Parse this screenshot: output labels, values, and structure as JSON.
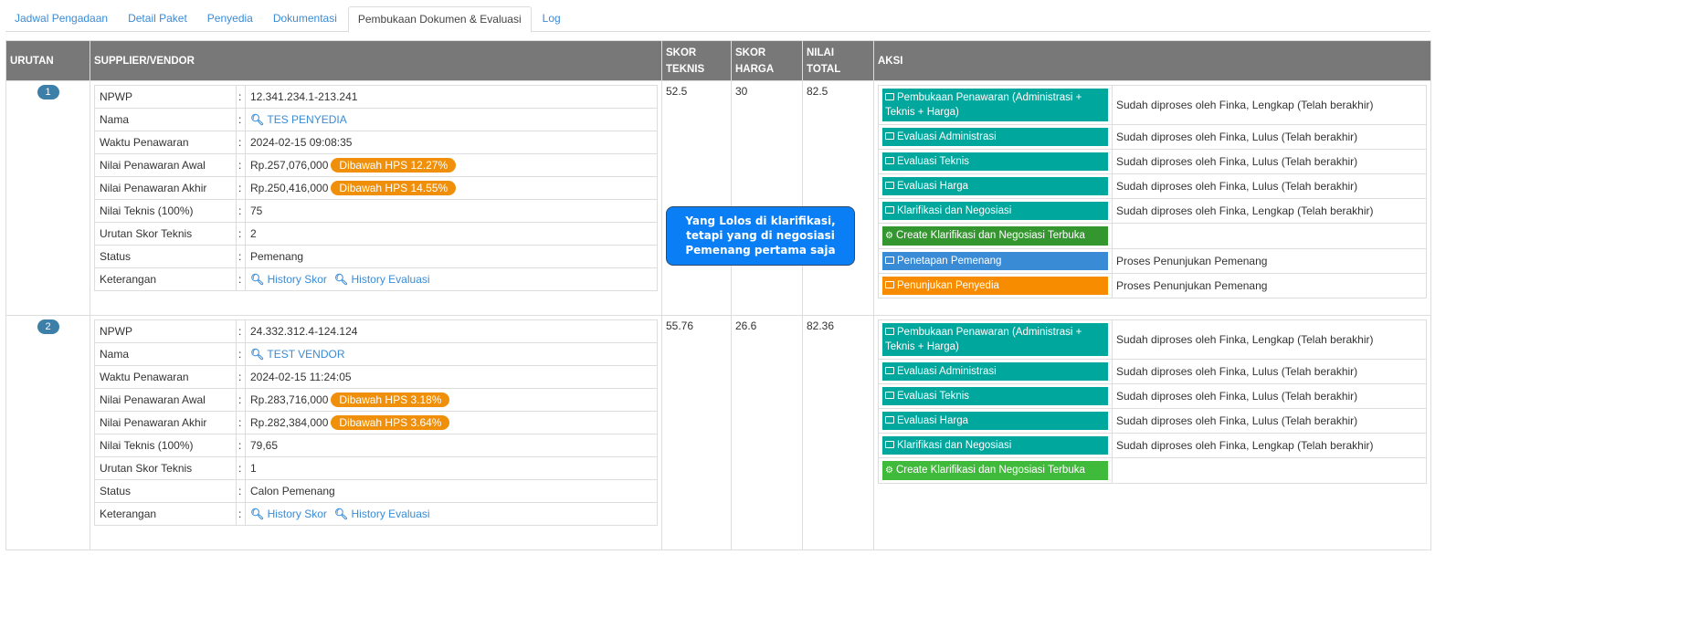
{
  "tabs": [
    "Jadwal Pengadaan",
    "Detail Paket",
    "Penyedia",
    "Dokumentasi",
    "Pembukaan Dokumen & Evaluasi",
    "Log"
  ],
  "active_tab": 4,
  "headers": {
    "urutan": "URUTAN",
    "supplier": "SUPPLIER/VENDOR",
    "skor_teknis": "SKOR TEKNIS",
    "skor_harga": "SKOR HARGA",
    "nilai_total": "NILAI TOTAL",
    "aksi": "AKSI"
  },
  "labels": [
    "NPWP",
    "Nama",
    "Waktu Penawaran",
    "Nilai Penawaran Awal",
    "Nilai Penawaran Akhir",
    "Nilai Teknis (100%)",
    "Urutan Skor Teknis",
    "Status",
    "Keterangan"
  ],
  "links": {
    "history_skor": "History Skor",
    "history_evaluasi": "History Evaluasi"
  },
  "rows": [
    {
      "urutan": "1",
      "npwp": "12.341.234.1-213.241",
      "nama": "TES PENYEDIA",
      "waktu": "2024-02-15 09:08:35",
      "awal": "Rp.257,076,000",
      "awal_badge": "Dibawah HPS 12.27%",
      "akhir": "Rp.250,416,000",
      "akhir_badge": "Dibawah HPS 14.55%",
      "nilai_teknis": "75",
      "urutan_skor": "2",
      "status": "Pemenang",
      "skor_teknis": "52.5",
      "skor_harga": "30",
      "nilai_total": "82.5",
      "aksi": [
        {
          "label": "Pembukaan Penawaran (Administrasi + Teknis + Harga)",
          "status": "Sudah diproses oleh Finka, Lengkap (Telah berakhir)",
          "color": "teal",
          "icon": "monitor"
        },
        {
          "label": "Evaluasi Administrasi",
          "status": "Sudah diproses oleh Finka, Lulus (Telah berakhir)",
          "color": "teal",
          "icon": "monitor"
        },
        {
          "label": "Evaluasi Teknis",
          "status": "Sudah diproses oleh Finka, Lulus (Telah berakhir)",
          "color": "teal",
          "icon": "monitor"
        },
        {
          "label": "Evaluasi Harga",
          "status": "Sudah diproses oleh Finka, Lulus (Telah berakhir)",
          "color": "teal",
          "icon": "monitor"
        },
        {
          "label": "Klarifikasi dan Negosiasi",
          "status": "Sudah diproses oleh Finka, Lengkap (Telah berakhir)",
          "color": "teal",
          "icon": "monitor"
        },
        {
          "label": "Create Klarifikasi dan Negosiasi Terbuka",
          "status": "",
          "color": "green",
          "icon": "gear"
        },
        {
          "label": "Penetapan Pemenang",
          "status": "Proses Penunjukan Pemenang",
          "color": "blue",
          "icon": "monitor"
        },
        {
          "label": "Penunjukan Penyedia",
          "status": "Proses Penunjukan Pemenang",
          "color": "orange",
          "icon": "monitor"
        }
      ]
    },
    {
      "urutan": "2",
      "npwp": "24.332.312.4-124.124",
      "nama": "TEST VENDOR",
      "waktu": "2024-02-15 11:24:05",
      "awal": "Rp.283,716,000",
      "awal_badge": "Dibawah HPS 3.18%",
      "akhir": "Rp.282,384,000",
      "akhir_badge": "Dibawah HPS 3.64%",
      "nilai_teknis": "79,65",
      "urutan_skor": "1",
      "status": "Calon Pemenang",
      "skor_teknis": "55.76",
      "skor_harga": "26.6",
      "nilai_total": "82.36",
      "aksi": [
        {
          "label": "Pembukaan Penawaran (Administrasi + Teknis + Harga)",
          "status": "Sudah diproses oleh Finka, Lengkap (Telah berakhir)",
          "color": "teal",
          "icon": "monitor"
        },
        {
          "label": "Evaluasi Administrasi",
          "status": "Sudah diproses oleh Finka, Lulus (Telah berakhir)",
          "color": "teal",
          "icon": "monitor"
        },
        {
          "label": "Evaluasi Teknis",
          "status": "Sudah diproses oleh Finka, Lulus (Telah berakhir)",
          "color": "teal",
          "icon": "monitor"
        },
        {
          "label": "Evaluasi Harga",
          "status": "Sudah diproses oleh Finka, Lulus (Telah berakhir)",
          "color": "teal",
          "icon": "monitor"
        },
        {
          "label": "Klarifikasi dan Negosiasi",
          "status": "Sudah diproses oleh Finka, Lengkap (Telah berakhir)",
          "color": "teal",
          "icon": "monitor"
        },
        {
          "label": "Create Klarifikasi dan Negosiasi Terbuka",
          "status": "",
          "color": "lgreen",
          "icon": "gear"
        }
      ]
    }
  ],
  "callout": "Yang Lolos di klarifikasi, tetapi yang di negosiasi Pemenang pertama saja"
}
